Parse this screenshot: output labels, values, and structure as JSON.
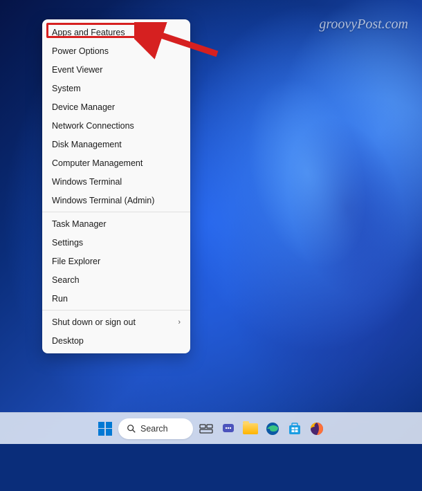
{
  "watermark": "groovyPost.com",
  "menu": {
    "groups": [
      [
        "Apps and Features",
        "Power Options",
        "Event Viewer",
        "System",
        "Device Manager",
        "Network Connections",
        "Disk Management",
        "Computer Management",
        "Windows Terminal",
        "Windows Terminal (Admin)"
      ],
      [
        "Task Manager",
        "Settings",
        "File Explorer",
        "Search",
        "Run"
      ],
      [
        {
          "label": "Shut down or sign out",
          "submenu": true
        },
        "Desktop"
      ]
    ]
  },
  "highlighted_item_index": 0,
  "taskbar": {
    "search_label": "Search"
  },
  "annotation": {
    "highlight_color": "#d62020",
    "arrow_color": "#d62020"
  }
}
